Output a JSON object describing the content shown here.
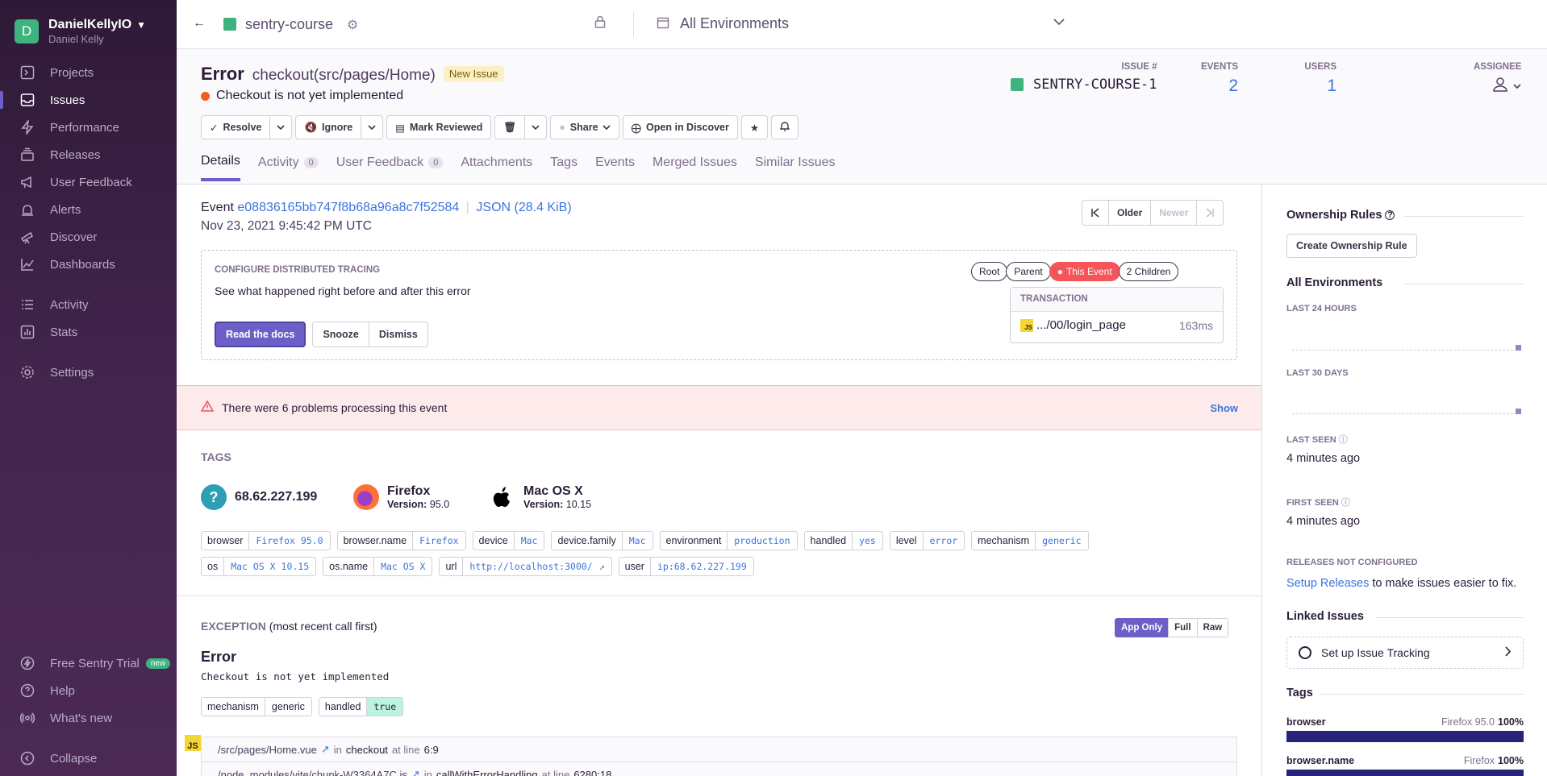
{
  "org": {
    "initial": "D",
    "name": "DanielKellyIO",
    "user": "Daniel Kelly"
  },
  "nav": {
    "projects": "Projects",
    "issues": "Issues",
    "performance": "Performance",
    "releases": "Releases",
    "user_feedback": "User Feedback",
    "alerts": "Alerts",
    "discover": "Discover",
    "dashboards": "Dashboards",
    "activity": "Activity",
    "stats": "Stats",
    "settings": "Settings",
    "trial": "Free Sentry Trial",
    "trial_badge": "new",
    "help": "Help",
    "whats_new": "What's new",
    "collapse": "Collapse"
  },
  "topbar": {
    "project": "sentry-course",
    "environment": "All Environments"
  },
  "issue": {
    "type": "Error",
    "culprit": "checkout(src/pages/Home)",
    "badge": "New Issue",
    "message": "Checkout is not yet implemented",
    "id_label": "Issue #",
    "id": "SENTRY-COURSE-1",
    "events_label": "Events",
    "events": "2",
    "users_label": "Users",
    "users": "1",
    "assignee_label": "Assignee"
  },
  "actions": {
    "resolve": "Resolve",
    "ignore": "Ignore",
    "mark_reviewed": "Mark Reviewed",
    "share": "Share",
    "open_discover": "Open in Discover"
  },
  "tabs": {
    "details": "Details",
    "activity": "Activity",
    "activity_count": "0",
    "user_feedback": "User Feedback",
    "user_feedback_count": "0",
    "attachments": "Attachments",
    "tags": "Tags",
    "events": "Events",
    "merged": "Merged Issues",
    "similar": "Similar Issues"
  },
  "event": {
    "label": "Event",
    "id": "e08836165bb747f8b68a96a8c7f52584",
    "json": "JSON (28.4 KiB)",
    "date": "Nov 23, 2021 9:45:42 PM UTC"
  },
  "pager": {
    "older": "Older",
    "newer": "Newer"
  },
  "tracing": {
    "title": "Configure Distributed Tracing",
    "subtitle": "See what happened right before and after this error",
    "read_docs": "Read the docs",
    "snooze": "Snooze",
    "dismiss": "Dismiss",
    "root": "Root",
    "parent": "Parent",
    "this_event": "This Event",
    "children": "2 Children",
    "tx_header": "Transaction",
    "tx_name": ".../00/login_page",
    "tx_duration": "163ms"
  },
  "problems": {
    "text": "There were 6 problems processing this event",
    "show": "Show"
  },
  "tags_section": {
    "title": "Tags",
    "ip": "68.62.227.199",
    "browser": "Firefox",
    "browser_version_label": "Version:",
    "browser_version": "95.0",
    "os": "Mac OS X",
    "os_version_label": "Version:",
    "os_version": "10.15",
    "row1": [
      {
        "k": "browser",
        "v": "Firefox 95.0"
      },
      {
        "k": "browser.name",
        "v": "Firefox"
      },
      {
        "k": "device",
        "v": "Mac"
      },
      {
        "k": "device.family",
        "v": "Mac"
      },
      {
        "k": "environment",
        "v": "production"
      },
      {
        "k": "handled",
        "v": "yes"
      },
      {
        "k": "level",
        "v": "error"
      },
      {
        "k": "mechanism",
        "v": "generic"
      }
    ],
    "row2": [
      {
        "k": "os",
        "v": "Mac OS X 10.15"
      },
      {
        "k": "os.name",
        "v": "Mac OS X"
      },
      {
        "k": "url",
        "v": "http://localhost:3000/"
      },
      {
        "k": "user",
        "v": "ip:68.62.227.199"
      }
    ]
  },
  "exception": {
    "title": "Exception",
    "subtitle": "(most recent call first)",
    "app_only": "App Only",
    "full": "Full",
    "raw": "Raw",
    "type": "Error",
    "value": "Checkout is not yet implemented",
    "mech_k": "mechanism",
    "mech_v": "generic",
    "handled_k": "handled",
    "handled_v": "true",
    "frame1_file": "/src/pages/Home.vue",
    "frame1_in": "in",
    "frame1_func": "checkout",
    "frame1_at": "at line",
    "frame1_line": "6:9",
    "frame2_file": "/node_modules/vite/chunk-W3364A7C.js",
    "frame2_in": "in",
    "frame2_func": "callWithErrorHandling",
    "frame2_at": "at line",
    "frame2_line": "6280:18"
  },
  "side": {
    "ownership": "Ownership Rules",
    "create_rule": "Create Ownership Rule",
    "all_env": "All Environments",
    "last24": "Last 24 Hours",
    "last30": "Last 30 Days",
    "last_seen_label": "Last Seen",
    "last_seen": "4 minutes ago",
    "first_seen_label": "First Seen",
    "first_seen": "4 minutes ago",
    "releases_label": "Releases not configured",
    "setup_releases": "Setup Releases",
    "releases_tail": "to make issues easier to fix.",
    "linked": "Linked Issues",
    "issue_tracking": "Set up Issue Tracking",
    "tags": "Tags",
    "tag1_name": "browser",
    "tag1_val": "Firefox 95.0",
    "tag1_pct": "100%",
    "tag2_name": "browser.name",
    "tag2_val": "Firefox",
    "tag2_pct": "100%"
  }
}
